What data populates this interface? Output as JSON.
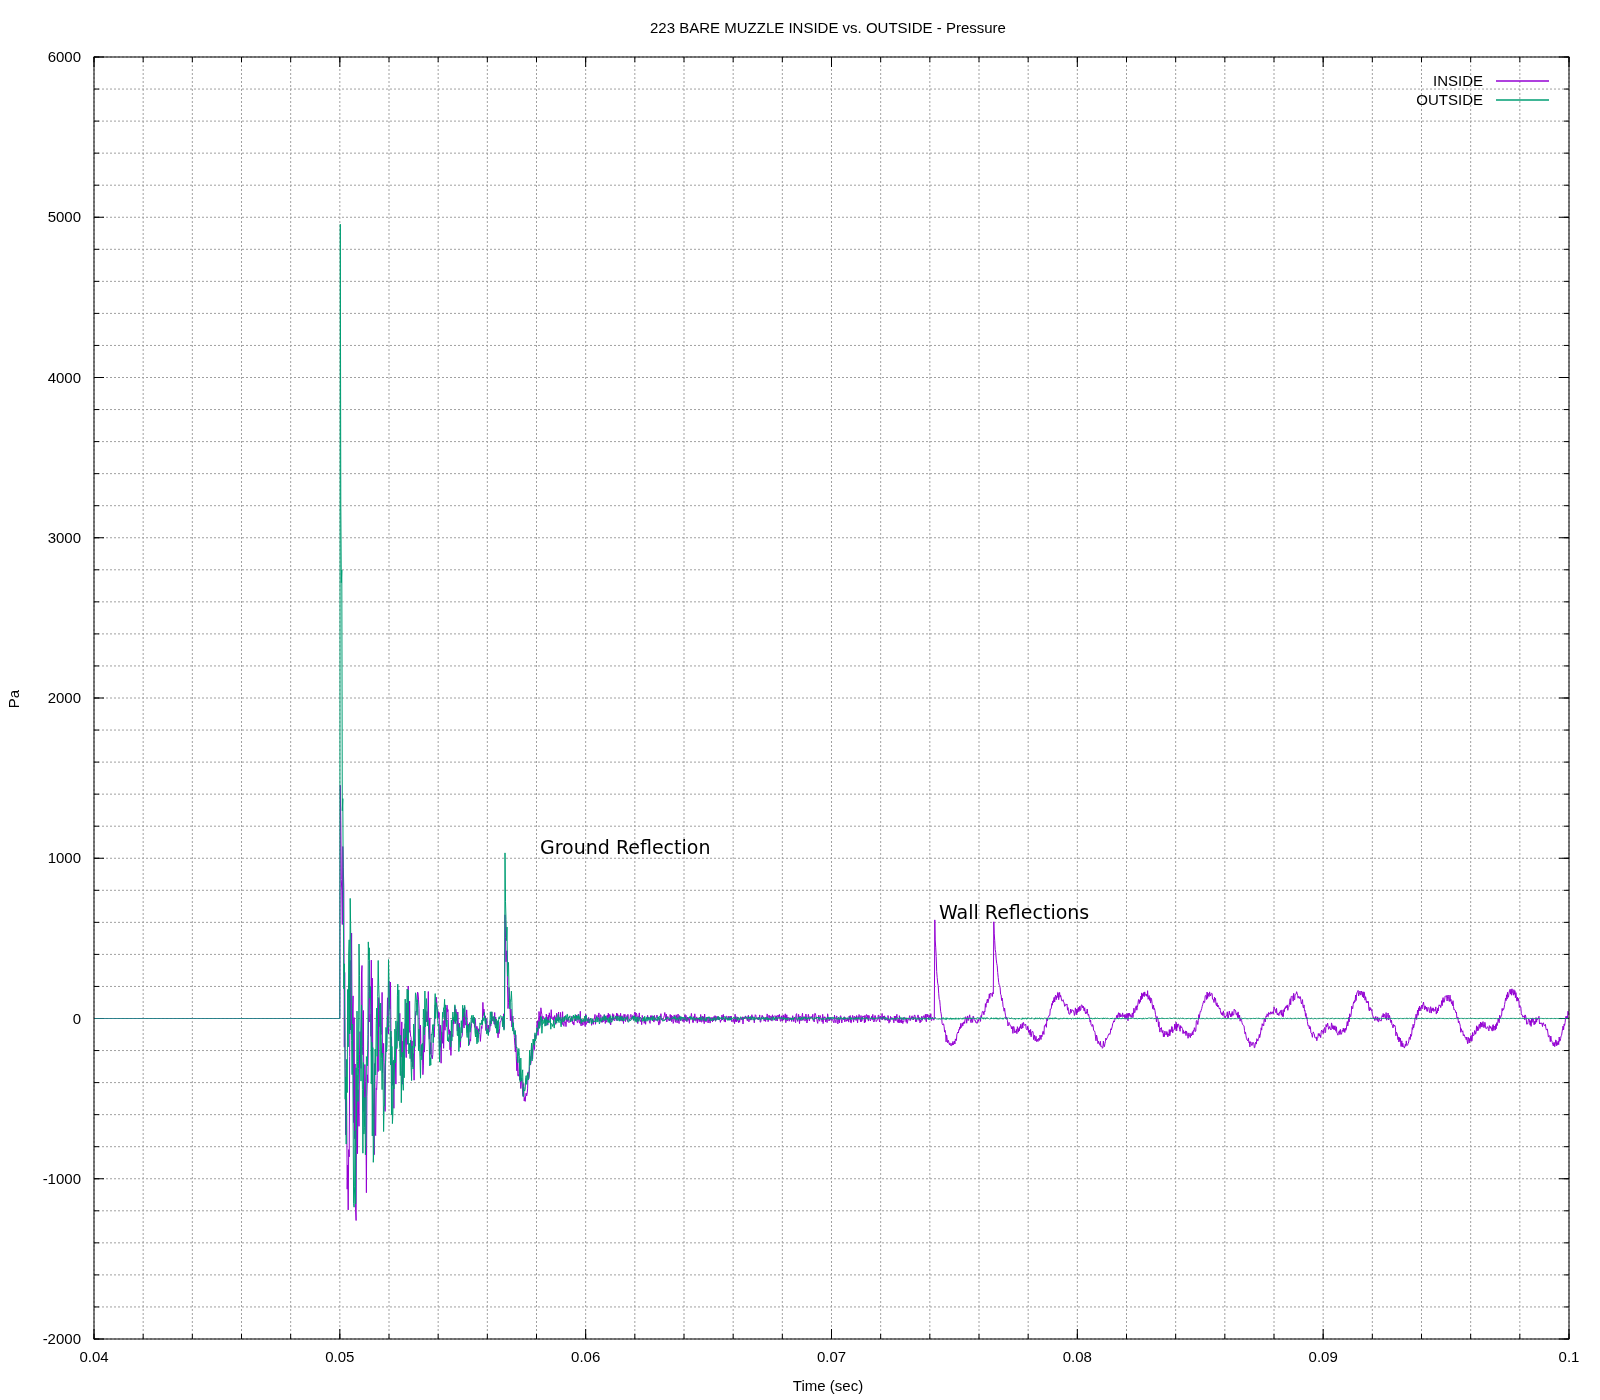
{
  "title": "223 BARE MUZZLE INSIDE vs. OUTSIDE - Pressure",
  "plot": {
    "y_label": "Pa",
    "x_label": "Time (sec)",
    "y_ticks": [
      "6000",
      "5000",
      "4000",
      "3000",
      "2000",
      "1000",
      "0",
      "-1000",
      "-2000"
    ],
    "x_ticks": [
      "0.04",
      "0.05",
      "0.06",
      "0.07",
      "0.08",
      "0.09",
      "0.1"
    ],
    "legend": [
      {
        "label": "INSIDE",
        "color": "#9400d3"
      },
      {
        "label": "OUTSIDE",
        "color": "#009e73"
      }
    ],
    "annotations": [
      {
        "text": "Ground Reflection"
      },
      {
        "text": "Wall Reflections"
      }
    ]
  }
}
